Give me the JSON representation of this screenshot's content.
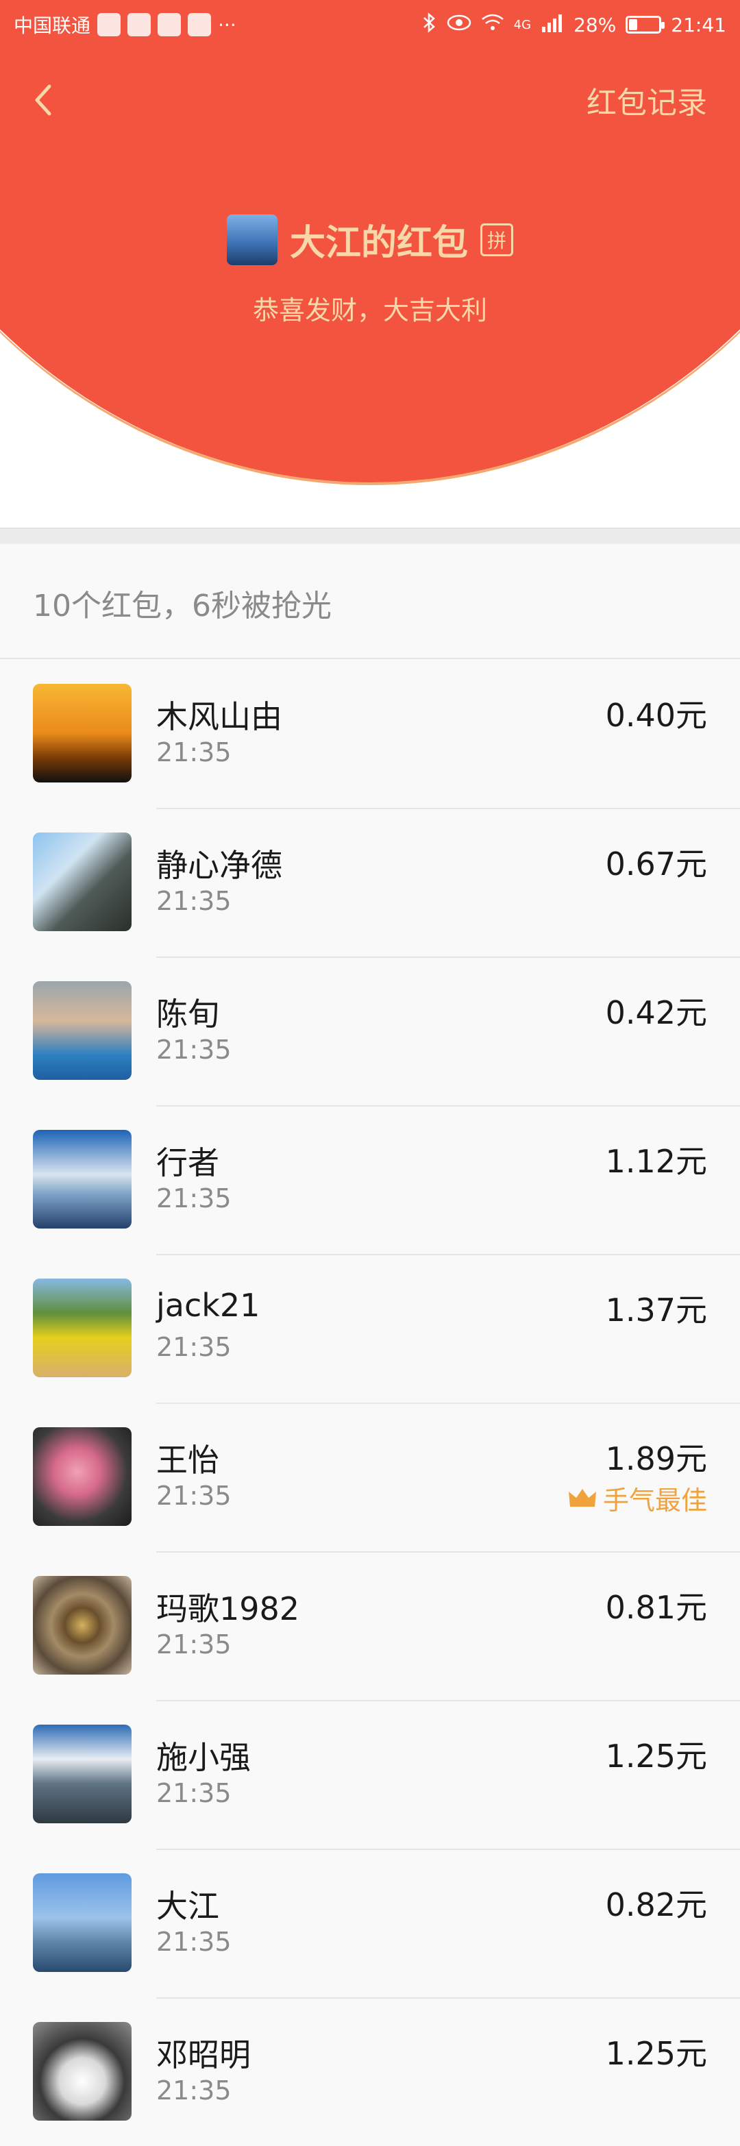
{
  "status_bar": {
    "carrier": "中国联通",
    "more": "···",
    "network": "4G",
    "battery": "28%",
    "battery_level": 0.28,
    "time": "21:41"
  },
  "topbar": {
    "back_icon": "chevron-left-icon",
    "record_link": "红包记录"
  },
  "sender": {
    "name": "大江的红包",
    "badge": "拼",
    "greeting": "恭喜发财，大吉大利"
  },
  "summary": "10个红包，6秒被抢光",
  "colors": {
    "header_red": "#f2543f",
    "gold_text": "#f8d7a8",
    "best_luck": "#f0a23c"
  },
  "records": [
    {
      "name": "木风山由",
      "time": "21:35",
      "amount": "0.40元"
    },
    {
      "name": "静心净德",
      "time": "21:35",
      "amount": "0.67元"
    },
    {
      "name": "陈旬",
      "time": "21:35",
      "amount": "0.42元"
    },
    {
      "name": "行者",
      "time": "21:35",
      "amount": "1.12元"
    },
    {
      "name": "jack21",
      "time": "21:35",
      "amount": "1.37元"
    },
    {
      "name": "王怡",
      "time": "21:35",
      "amount": "1.89元",
      "best": "手气最佳"
    },
    {
      "name": "玛歌1982",
      "time": "21:35",
      "amount": "0.81元"
    },
    {
      "name": "施小强",
      "time": "21:35",
      "amount": "1.25元"
    },
    {
      "name": "大江",
      "time": "21:35",
      "amount": "0.82元"
    },
    {
      "name": "邓昭明",
      "time": "21:35",
      "amount": "1.25元"
    }
  ]
}
